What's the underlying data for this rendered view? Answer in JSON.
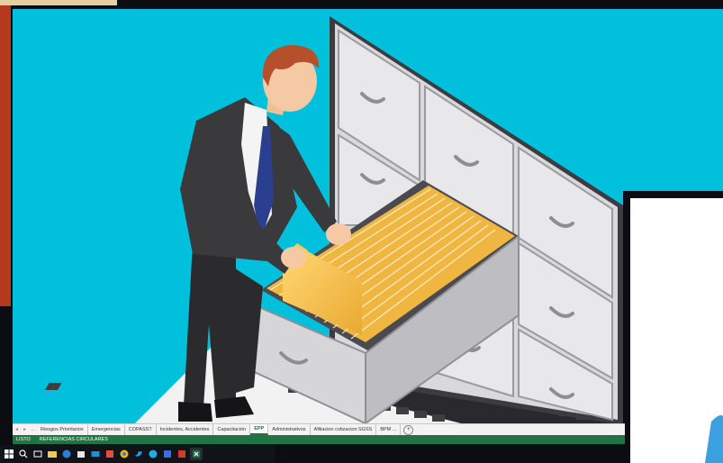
{
  "sheet_tabs": {
    "nav_prev": "◂",
    "nav_next": "▸",
    "ellipsis": "...",
    "tabs": [
      {
        "label": "Riesgos Prioritarios",
        "active": false
      },
      {
        "label": "Emergencias",
        "active": false
      },
      {
        "label": "COPASST",
        "active": false
      },
      {
        "label": "Incidentes, Accidentes",
        "active": false
      },
      {
        "label": "Capacitación",
        "active": false
      },
      {
        "label": "EPP",
        "active": true
      },
      {
        "label": "Administrativos",
        "active": false
      },
      {
        "label": "Afiliacion cotizacion SGSS",
        "active": false
      },
      {
        "label": "BPM ...",
        "active": false
      }
    ],
    "add_sheet": "+"
  },
  "status_bar": {
    "ready": "LISTO",
    "circular": "REFERENCIAS CIRCULARES"
  },
  "taskbar": {
    "icons": [
      "windows-start-icon",
      "search-icon",
      "task-view-icon",
      "file-explorer-icon",
      "edge-icon",
      "store-icon",
      "mail-icon",
      "media-icon",
      "chrome-icon",
      "twitter-icon",
      "skype-icon",
      "maps-icon",
      "acrobat-icon",
      "excel-icon"
    ]
  },
  "colors": {
    "scene_background": "#00c0dc",
    "cabinet": "#e4e4e4",
    "folder": "#f5c146",
    "suit": "#3a3a3c",
    "tie": "#2b3f8f",
    "hair": "#b5502d",
    "excel_green": "#217346"
  }
}
